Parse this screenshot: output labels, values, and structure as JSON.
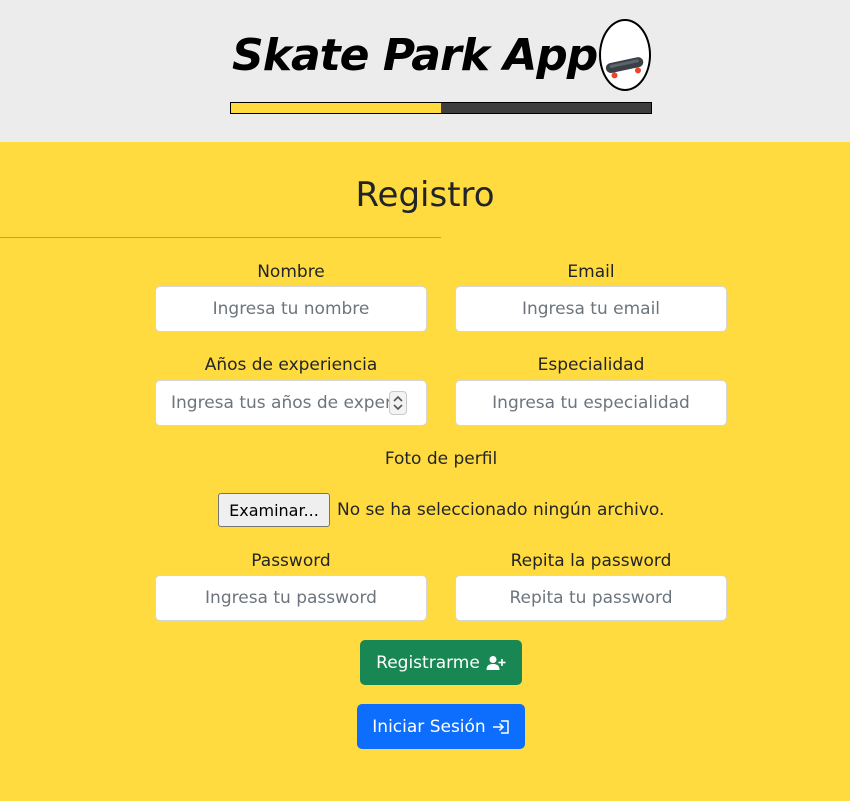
{
  "header": {
    "app_title": "Skate Park App",
    "logo_icon": "skateboard-icon",
    "progress": 0.5,
    "progress_color": "#ffdb3f",
    "progress_track_color": "#3e3e3e",
    "background": "#ececec"
  },
  "page": {
    "background": "#ffdb3f"
  },
  "form": {
    "title": "Registro",
    "nombre": {
      "label": "Nombre",
      "placeholder": "Ingresa tu nombre"
    },
    "email": {
      "label": "Email",
      "placeholder": "Ingresa tu email"
    },
    "experiencia": {
      "label": "Años de experiencia",
      "placeholder": "Ingresa tus años de experiencia"
    },
    "especialidad": {
      "label": "Especialidad",
      "placeholder": "Ingresa tu especialidad"
    },
    "foto": {
      "label": "Foto de perfil",
      "button": "Examinar...",
      "status": "No se ha seleccionado ningún archivo."
    },
    "password": {
      "label": "Password",
      "placeholder": "Ingresa tu password"
    },
    "password2": {
      "label": "Repita la password",
      "placeholder": "Repita tu password"
    }
  },
  "buttons": {
    "register": {
      "label": "Registrarme",
      "icon": "person-plus-icon",
      "color": "#198754"
    },
    "login": {
      "label": "Iniciar Sesión",
      "icon": "box-arrow-in-right-icon",
      "color": "#0d6efd"
    }
  }
}
